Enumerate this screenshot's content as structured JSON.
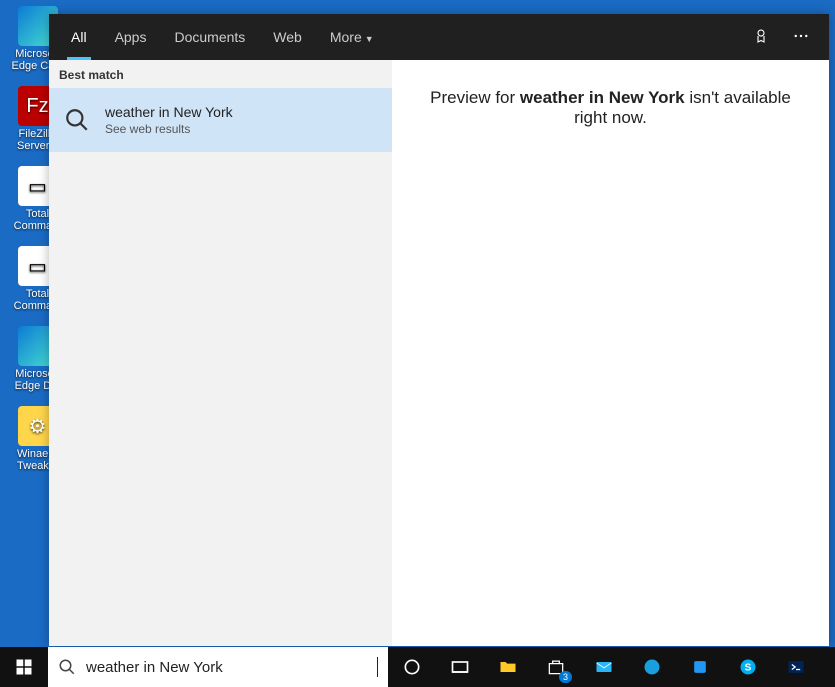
{
  "desktop_icons": [
    {
      "label": "Microsoft Edge Ca..."
    },
    {
      "label": "FileZilla Server..."
    },
    {
      "label": "Total Comma..."
    },
    {
      "label": "Total Comma..."
    },
    {
      "label": "Microsoft Edge D..."
    },
    {
      "label": "Winaero Tweak..."
    }
  ],
  "tabs": {
    "all": "All",
    "apps": "Apps",
    "documents": "Documents",
    "web": "Web",
    "more": "More"
  },
  "results": {
    "section": "Best match",
    "item": {
      "title": "weather in New York",
      "sub": "See web results"
    }
  },
  "preview": {
    "pre": "Preview for ",
    "term": "weather in New York",
    "post": " isn't available right now."
  },
  "search": {
    "value": "weather in New York"
  },
  "badge": "3"
}
